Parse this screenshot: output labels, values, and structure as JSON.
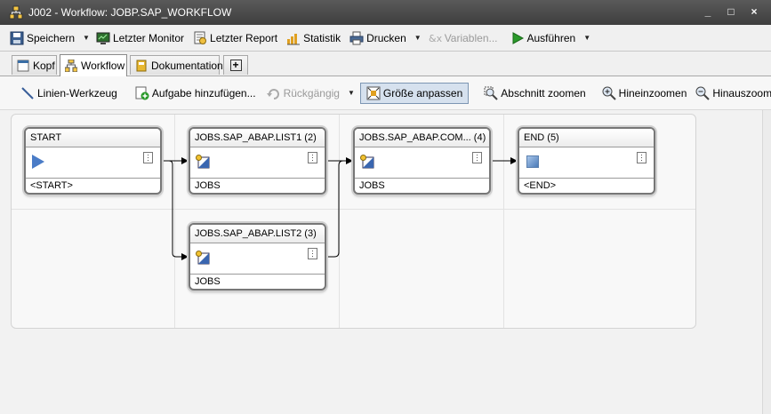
{
  "window": {
    "title": "J002 - Workflow: JOBP.SAP_WORKFLOW",
    "minimize": "_",
    "maximize": "□",
    "close": "×"
  },
  "toolbar": {
    "save": "Speichern",
    "last_monitor": "Letzter Monitor",
    "last_report": "Letzter Report",
    "statistics": "Statistik",
    "print": "Drucken",
    "variables": "Variablen...",
    "execute": "Ausführen"
  },
  "tabs": [
    {
      "label": "Kopf"
    },
    {
      "label": "Workflow"
    },
    {
      "label": "Dokumentation"
    },
    {
      "label": "+"
    }
  ],
  "workflow_toolbar": {
    "line_tool": "Linien-Werkzeug",
    "add_task": "Aufgabe hinzufügen...",
    "undo": "Rückgängig",
    "fit_size": "Größe anpassen",
    "zoom_section": "Abschnitt zoomen",
    "zoom_in": "Hineinzoomen",
    "zoom_out": "Hinauszoomen"
  },
  "nodes": [
    {
      "title": "START",
      "footer": "<START>",
      "icon": "play-icon"
    },
    {
      "title": "JOBS.SAP_ABAP.LIST1 (2)",
      "footer": "JOBS",
      "icon": "sap-job-icon"
    },
    {
      "title": "JOBS.SAP_ABAP.COM... (4)",
      "footer": "JOBS",
      "icon": "sap-job-icon"
    },
    {
      "title": "END (5)",
      "footer": "<END>",
      "icon": "end-icon"
    },
    {
      "title": "JOBS.SAP_ABAP.LIST2 (3)",
      "footer": "JOBS",
      "icon": "sap-job-icon"
    }
  ],
  "colors": {
    "accent": "#4a7cc7",
    "titlebar": "#4a4a4a",
    "pressed": "#d6e1ee"
  }
}
